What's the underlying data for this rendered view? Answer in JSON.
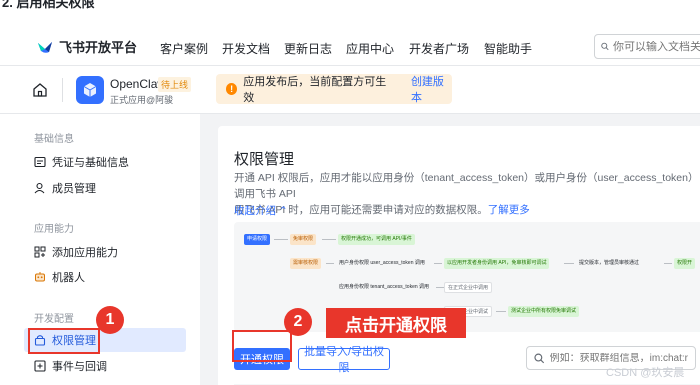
{
  "caption": "2. 启用相关权限",
  "nav": {
    "brand": "飞书开放平台",
    "items": [
      "客户案例",
      "开发文档",
      "更新日志",
      "应用中心",
      "开发者广场",
      "智能助手"
    ],
    "search_placeholder": "你可以输入文档关键词"
  },
  "app": {
    "name": "OpenClaw",
    "badge": "待上线",
    "subtitle": "正式应用@阿骏",
    "notice": "应用发布后，当前配置方可生效",
    "notice_link": "创建版本"
  },
  "sidebar": {
    "sections": [
      {
        "title": "基础信息",
        "items": [
          {
            "label": "凭证与基础信息",
            "icon": "credential-icon"
          },
          {
            "label": "成员管理",
            "icon": "member-icon"
          }
        ]
      },
      {
        "title": "应用能力",
        "items": [
          {
            "label": "添加应用能力",
            "icon": "add-capability-icon"
          },
          {
            "label": "机器人",
            "icon": "robot-icon"
          }
        ]
      },
      {
        "title": "开发配置",
        "items": [
          {
            "label": "权限管理",
            "icon": "permission-icon",
            "active": true
          },
          {
            "label": "事件与回调",
            "icon": "event-icon"
          }
        ]
      }
    ]
  },
  "main": {
    "title": "权限管理",
    "desc_line1": "开通 API 权限后，应用才能以应用身份（tenant_access_token）或用户身份（user_access_token）调用飞书 API",
    "desc_line2": "用飞书 API 时，应用可能还需要申请对应的数据权限。",
    "desc_link": "了解更多",
    "collapse_label": "收起介绍 ⌃",
    "flow": {
      "apply": "申请权限",
      "grant": "免审权限",
      "grant_ok": "权限开通成功，可调用 API/事件",
      "review": "需审核权限",
      "user_identity": "用户身份权限 user_access_token 调用",
      "test_enterprise": "以应用开发者身份调用 API，免审核即可调试",
      "submit": "提交版本，管理员审核通过",
      "grant_ok2": "权限开",
      "app_identity": "应用身份权限 tenant_access_token 调用",
      "prod": "在正式企业中调用",
      "test_call": "在测试企业中调试",
      "test_free": "测试企业中所有权限免审调试"
    },
    "enable_button": "开通权限",
    "batch_button": "批量导入/导出权限",
    "search_placeholder": "例如：获取群组信息，im:chat:r",
    "search_suffix": "权"
  },
  "annotations": {
    "step1": "1",
    "step2": "2",
    "step2_label": "点击开通权限"
  },
  "watermark": "CSDN @玖安晨",
  "colors": {
    "primary": "#3370ff",
    "annotation": "#e8362b",
    "warning_bg": "#fdf0dd"
  }
}
